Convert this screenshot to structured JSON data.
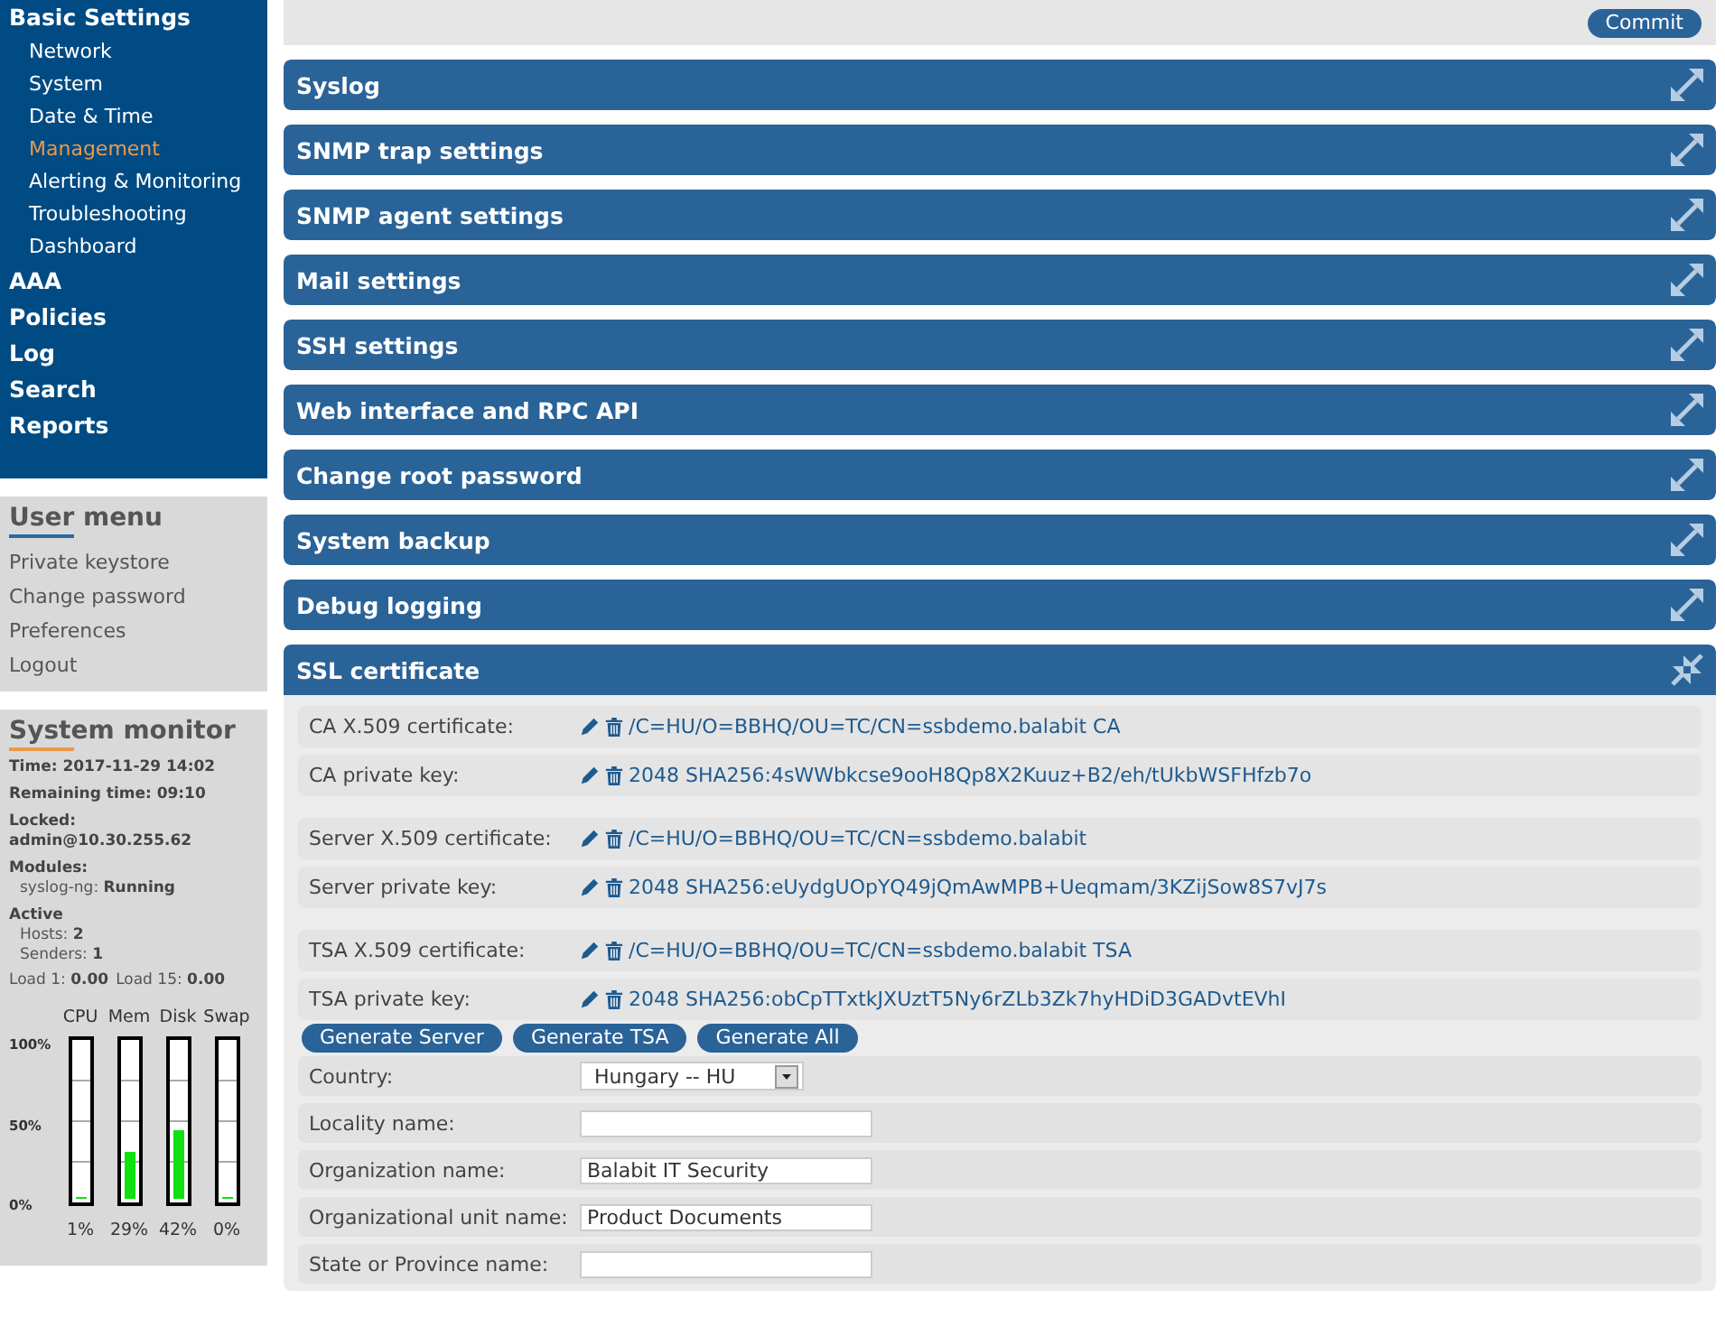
{
  "nav": [
    {
      "label": "Basic Settings",
      "selected": false,
      "children": [
        {
          "label": "Network",
          "selected": false
        },
        {
          "label": "System",
          "selected": false
        },
        {
          "label": "Date & Time",
          "selected": false
        },
        {
          "label": "Management",
          "selected": true
        },
        {
          "label": "Alerting & Monitoring",
          "selected": false
        },
        {
          "label": "Troubleshooting",
          "selected": false
        },
        {
          "label": "Dashboard",
          "selected": false
        }
      ]
    },
    {
      "label": "AAA",
      "selected": false
    },
    {
      "label": "Policies",
      "selected": false
    },
    {
      "label": "Log",
      "selected": false
    },
    {
      "label": "Search",
      "selected": false
    },
    {
      "label": "Reports",
      "selected": false
    }
  ],
  "user_menu": {
    "title": "User menu",
    "items": [
      "Private keystore",
      "Change password",
      "Preferences",
      "Logout"
    ]
  },
  "system_monitor": {
    "title": "System monitor",
    "lines": [
      {
        "label": "Time:",
        "value": "2017-11-29 14:02",
        "kind": "inline"
      },
      {
        "label": "Remaining time:",
        "value": "09:10",
        "kind": "inline"
      },
      {
        "label": "Locked:",
        "value": "admin@10.30.255.62",
        "kind": "block"
      },
      {
        "label": "Modules:",
        "kind": "heading"
      }
    ],
    "modules": [
      {
        "name": "syslog-ng:",
        "status": "Running"
      }
    ],
    "active": {
      "label": "Active",
      "items": [
        {
          "name": "Hosts:",
          "value": "2"
        },
        {
          "name": "Senders:",
          "value": "1"
        }
      ]
    },
    "loads": [
      {
        "name": "Load 1:",
        "value": "0.00"
      },
      {
        "name": "Load 15:",
        "value": "0.00"
      }
    ],
    "axis_labels": [
      "100%",
      "50%",
      "0%"
    ],
    "meters": [
      {
        "name": "CPU",
        "level": 0.01,
        "reading": "1%"
      },
      {
        "name": "Mem",
        "level": 0.29,
        "reading": "29%"
      },
      {
        "name": "Disk",
        "level": 0.42,
        "reading": "42%"
      },
      {
        "name": "Swap",
        "level": 0,
        "reading": "0%"
      }
    ]
  },
  "commit_button": "Commit",
  "panels": [
    {
      "title": "Syslog",
      "expanded": false
    },
    {
      "title": "SNMP trap settings",
      "expanded": false
    },
    {
      "title": "SNMP agent settings",
      "expanded": false
    },
    {
      "title": "Mail settings",
      "expanded": false
    },
    {
      "title": "SSH settings",
      "expanded": false
    },
    {
      "title": "Web interface and RPC API",
      "expanded": false
    },
    {
      "title": "Change root password",
      "expanded": false
    },
    {
      "title": "System backup",
      "expanded": false
    },
    {
      "title": "Debug logging",
      "expanded": false
    },
    {
      "title": "SSL certificate",
      "expanded": true
    }
  ],
  "ssl": {
    "groups": [
      [
        {
          "label": "CA X.509 certificate:",
          "value": "/C=HU/O=BBHQ/OU=TC/CN=ssbdemo.balabit CA"
        },
        {
          "label": "CA private key:",
          "value": "2048 SHA256:4sWWbkcse9ooH8Qp8X2Kuuz+B2/eh/tUkbWSFHfzb7o"
        }
      ],
      [
        {
          "label": "Server X.509 certificate:",
          "value": "/C=HU/O=BBHQ/OU=TC/CN=ssbdemo.balabit"
        },
        {
          "label": "Server private key:",
          "value": "2048 SHA256:eUydgUOpYQ49jQmAwMPB+Ueqmam/3KZijSow8S7vJ7s"
        }
      ],
      [
        {
          "label": "TSA X.509 certificate:",
          "value": "/C=HU/O=BBHQ/OU=TC/CN=ssbdemo.balabit TSA"
        },
        {
          "label": "TSA private key:",
          "value": "2048 SHA256:obCpTTxtkJXUztT5Ny6rZLb3Zk7hyHDiD3GADvtEVhI"
        }
      ]
    ],
    "buttons": [
      "Generate Server",
      "Generate TSA",
      "Generate All"
    ],
    "fields": [
      {
        "label": "Country:",
        "kind": "select",
        "value": "Hungary -- HU"
      },
      {
        "label": "Locality name:",
        "kind": "text"
      },
      {
        "label": "Organization name:",
        "kind": "text",
        "value": "Balabit IT Security"
      },
      {
        "label": "Organizational unit name:",
        "kind": "text",
        "value": "Product Documents"
      },
      {
        "label": "State or Province name:",
        "kind": "text"
      }
    ]
  }
}
